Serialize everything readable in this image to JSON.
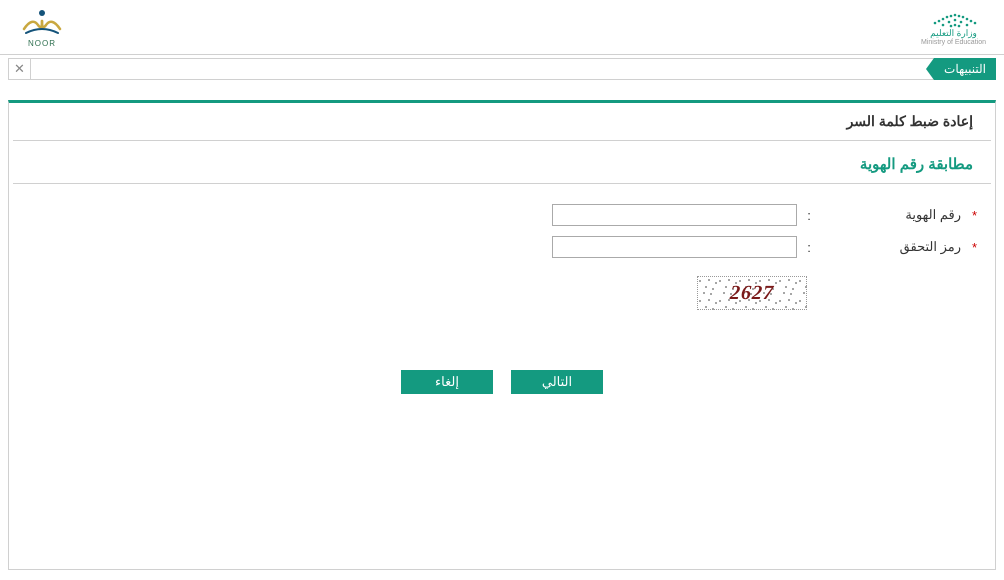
{
  "header": {
    "ministry_text_ar": "وزارة التعليم",
    "ministry_text_en": "Ministry of Education",
    "noor_text": "NOOR"
  },
  "notifications": {
    "tab_label": "التنبيهات",
    "close_glyph": "✕"
  },
  "main": {
    "page_title": "إعادة ضبط كلمة السر",
    "section_title": "مطابقة رقم الهوية",
    "fields": {
      "id": {
        "label": "رقم الهوية",
        "required": "*",
        "colon": ":",
        "value": ""
      },
      "captcha": {
        "label": "رمز التحقق",
        "required": "*",
        "colon": ":",
        "value": ""
      }
    },
    "captcha_code": "2627",
    "buttons": {
      "next": "التالي",
      "cancel": "إلغاء"
    }
  },
  "colors": {
    "accent": "#149a80"
  }
}
